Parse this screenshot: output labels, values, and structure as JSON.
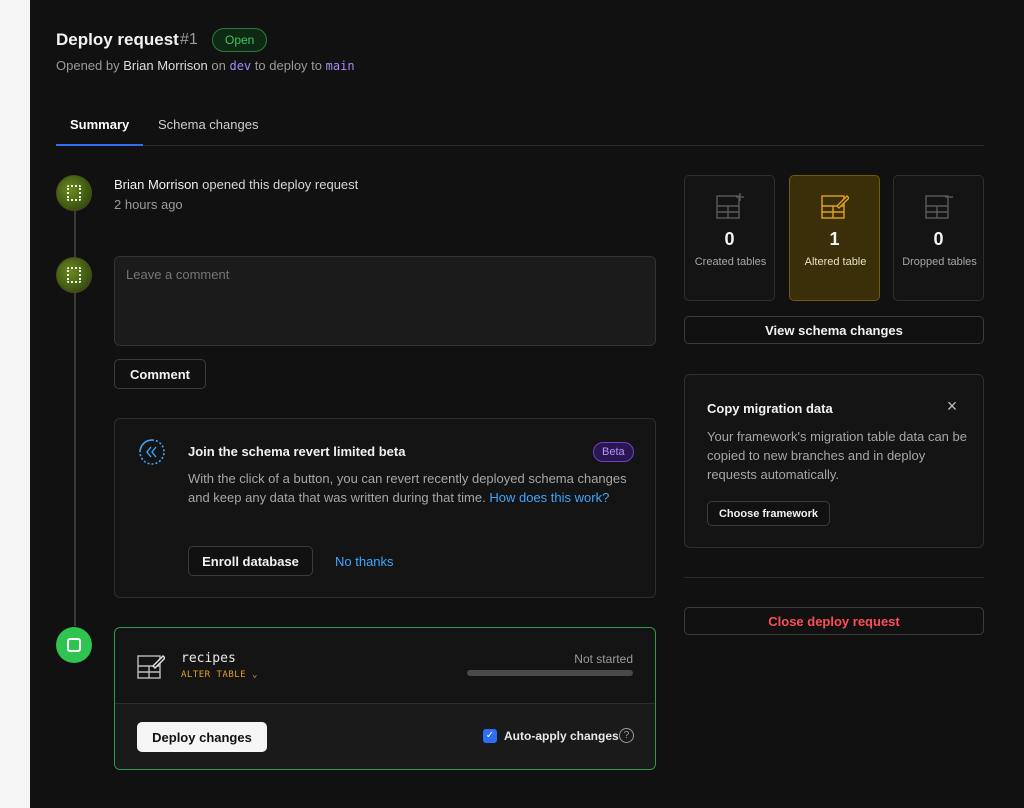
{
  "header": {
    "title": "Deploy request",
    "number": "#1",
    "status": "Open",
    "subtitle_prefix": "Opened by",
    "author": "Brian Morrison",
    "subtitle_on": "on",
    "source_branch": "dev",
    "subtitle_to": "to deploy to",
    "target_branch": "main"
  },
  "tabs": [
    {
      "label": "Summary",
      "active": true
    },
    {
      "label": "Schema changes",
      "active": false
    }
  ],
  "timeline": {
    "event_author": "Brian Morrison",
    "event_action": "opened this deploy request",
    "event_time": "2 hours ago",
    "comment_placeholder": "Leave a comment",
    "comment_button": "Comment"
  },
  "beta_card": {
    "title": "Join the schema revert limited beta",
    "badge": "Beta",
    "description": "With the click of a button, you can revert recently deployed schema changes and keep any data that was written during that time.",
    "link": "How does this work?",
    "enroll_button": "Enroll database",
    "decline_link": "No thanks",
    "icon": "revert-icon"
  },
  "deploy_card": {
    "table_name": "recipes",
    "operation": "ALTER TABLE",
    "status": "Not started",
    "progress": 0,
    "deploy_button": "Deploy changes",
    "auto_apply_label": "Auto-apply changes",
    "auto_apply_checked": true,
    "help_icon": "?",
    "accent": "#2ec44f"
  },
  "stats": [
    {
      "count": "0",
      "label": "Created tables",
      "icon": "table-add-icon"
    },
    {
      "count": "1",
      "label": "Altered table",
      "icon": "table-edit-icon",
      "highlight": true
    },
    {
      "count": "0",
      "label": "Dropped tables",
      "icon": "table-remove-icon"
    }
  ],
  "sidebar": {
    "view_schema_button": "View schema changes",
    "copy_card": {
      "title": "Copy migration data",
      "description": "Your framework's migration table data can be copied to new branches and in deploy requests automatically.",
      "button": "Choose framework"
    },
    "close_button": "Close deploy request"
  },
  "colors": {
    "background": "#111111",
    "accent_blue": "#2f6df6",
    "link_blue": "#3ea6ff",
    "success_green": "#2ec44f",
    "danger_red": "#ff4d57",
    "highlight_amber": "#3a2f08"
  }
}
